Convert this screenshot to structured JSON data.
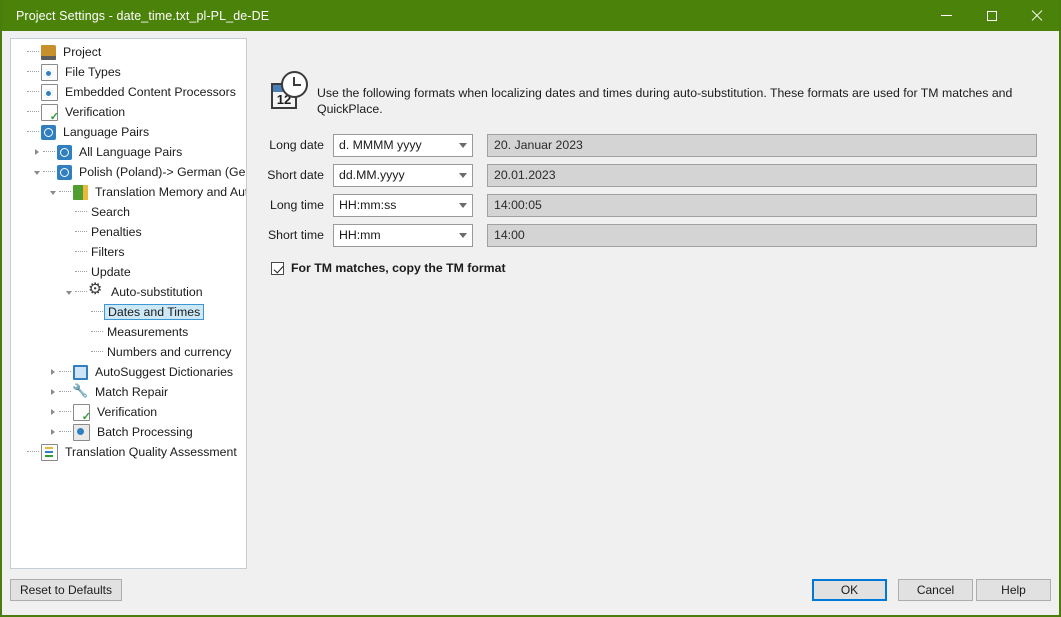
{
  "window": {
    "title": "Project Settings - date_time.txt_pl-PL_de-DE",
    "controls": {
      "minimize": "minimize-button",
      "maximize": "maximize-button",
      "close": "close-button"
    },
    "accent_color": "#4b8209"
  },
  "tree": {
    "items": [
      {
        "label": "Project",
        "depth": 0,
        "icon": "project-icon",
        "expander": "none",
        "selected": false
      },
      {
        "label": "File Types",
        "depth": 0,
        "icon": "document-icon",
        "expander": "none",
        "selected": false
      },
      {
        "label": "Embedded Content Processors",
        "depth": 0,
        "icon": "document-icon",
        "expander": "none",
        "selected": false
      },
      {
        "label": "Verification",
        "depth": 0,
        "icon": "verification-icon",
        "expander": "none",
        "selected": false
      },
      {
        "label": "Language Pairs",
        "depth": 0,
        "icon": "globe-icon",
        "expander": "none",
        "selected": false
      },
      {
        "label": "All Language Pairs",
        "depth": 1,
        "icon": "globe-icon",
        "expander": "collapsed",
        "selected": false
      },
      {
        "label": "Polish (Poland)-> German (Germany)",
        "depth": 1,
        "icon": "globe-icon",
        "expander": "open",
        "selected": false
      },
      {
        "label": "Translation Memory and Automat",
        "depth": 2,
        "icon": "translation-memory-icon",
        "expander": "open",
        "selected": false
      },
      {
        "label": "Search",
        "depth": 3,
        "icon": "none",
        "expander": "none",
        "selected": false
      },
      {
        "label": "Penalties",
        "depth": 3,
        "icon": "none",
        "expander": "none",
        "selected": false
      },
      {
        "label": "Filters",
        "depth": 3,
        "icon": "none",
        "expander": "none",
        "selected": false
      },
      {
        "label": "Update",
        "depth": 3,
        "icon": "none",
        "expander": "none",
        "selected": false
      },
      {
        "label": "Auto-substitution",
        "depth": 3,
        "icon": "gear-icon",
        "expander": "open",
        "selected": false
      },
      {
        "label": "Dates and Times",
        "depth": 4,
        "icon": "none",
        "expander": "none",
        "selected": true
      },
      {
        "label": "Measurements",
        "depth": 4,
        "icon": "none",
        "expander": "none",
        "selected": false
      },
      {
        "label": "Numbers and currency",
        "depth": 4,
        "icon": "none",
        "expander": "none",
        "selected": false
      },
      {
        "label": "AutoSuggest Dictionaries",
        "depth": 2,
        "icon": "autosuggest-icon",
        "expander": "collapsed",
        "selected": false
      },
      {
        "label": "Match Repair",
        "depth": 2,
        "icon": "wrench-icon",
        "expander": "collapsed",
        "selected": false
      },
      {
        "label": "Verification",
        "depth": 2,
        "icon": "verification-icon",
        "expander": "collapsed",
        "selected": false
      },
      {
        "label": "Batch Processing",
        "depth": 2,
        "icon": "batch-icon",
        "expander": "collapsed",
        "selected": false
      },
      {
        "label": "Translation Quality Assessment",
        "depth": 0,
        "icon": "tqa-icon",
        "expander": "none",
        "selected": false
      }
    ]
  },
  "panel": {
    "icon_name": "calendar-clock-icon",
    "calendar_number": "12",
    "description": "Use the following formats when localizing dates and times during auto-substitution. These formats are used for TM matches and QuickPlace.",
    "rows": [
      {
        "label": "Long date",
        "format": "d. MMMM yyyy",
        "preview": "20. Januar 2023"
      },
      {
        "label": "Short date",
        "format": "dd.MM.yyyy",
        "preview": "20.01.2023"
      },
      {
        "label": "Long time",
        "format": "HH:mm:ss",
        "preview": "14:00:05"
      },
      {
        "label": "Short time",
        "format": "HH:mm",
        "preview": "14:00"
      }
    ],
    "checkbox": {
      "label": "For TM matches, copy the TM format",
      "checked": true
    }
  },
  "footer": {
    "reset_label": "Reset to Defaults",
    "ok_label": "OK",
    "cancel_label": "Cancel",
    "help_label": "Help"
  }
}
